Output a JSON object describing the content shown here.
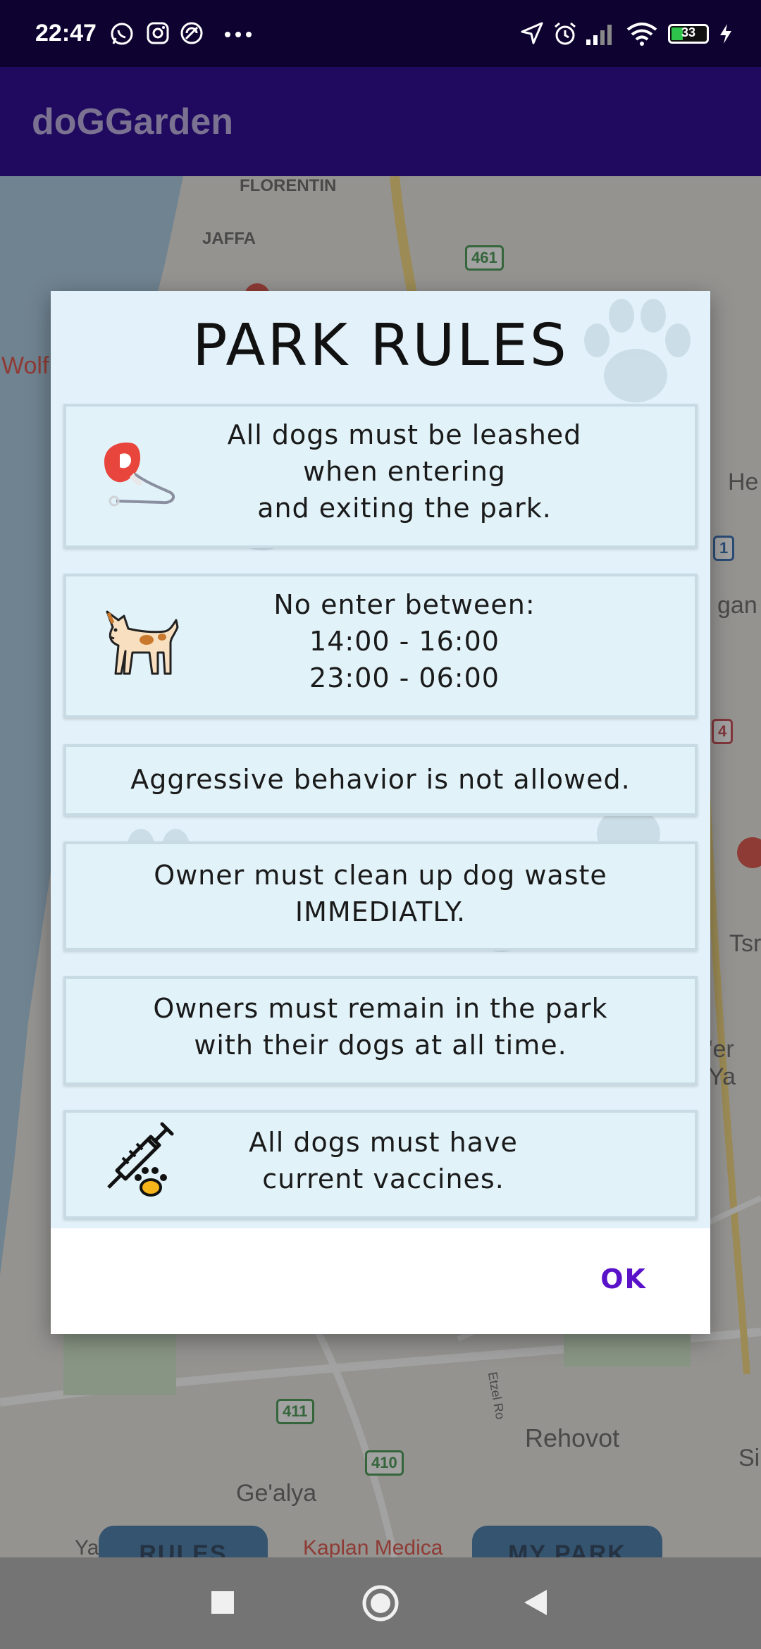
{
  "status_bar": {
    "time": "22:47",
    "battery_level": "33"
  },
  "app_bar": {
    "title": "doGGarden"
  },
  "map": {
    "labels": [
      "FLORENTIN",
      "JAFFA",
      "Wolf",
      "He",
      "gan",
      "Tsr",
      "'er Ya",
      "Rehovot",
      "Ge'alya",
      "Si",
      "Ya",
      "Kaplan Medica",
      "Etzel Ro"
    ],
    "shields": [
      "461",
      "1",
      "4",
      "411",
      "410"
    ]
  },
  "bottom_buttons": {
    "rules": "RULES",
    "my_park": "MY PARK"
  },
  "dialog": {
    "title": "PARK RULES",
    "rules": [
      {
        "text": "All dogs must be leashed\nwhen entering\nand exiting the park.",
        "icon": "leash-icon"
      },
      {
        "text": "No enter between:\n14:00 - 16:00\n23:00 - 06:00",
        "icon": "dog-icon"
      },
      {
        "text": "Aggressive behavior is not allowed.",
        "icon": ""
      },
      {
        "text": "Owner must clean up dog waste\nIMMEDIATLY.",
        "icon": ""
      },
      {
        "text": "Owners must remain in the park\nwith their dogs at all time.",
        "icon": ""
      },
      {
        "text": "All dogs must have\ncurrent vaccines.",
        "icon": "syringe-paw-icon"
      }
    ],
    "ok_label": "OK"
  },
  "colors": {
    "app_bar": "#1f0a60",
    "status_bar": "#0e0330",
    "accent": "#5a12c9",
    "dialog_bg": "#e3f2fa"
  }
}
